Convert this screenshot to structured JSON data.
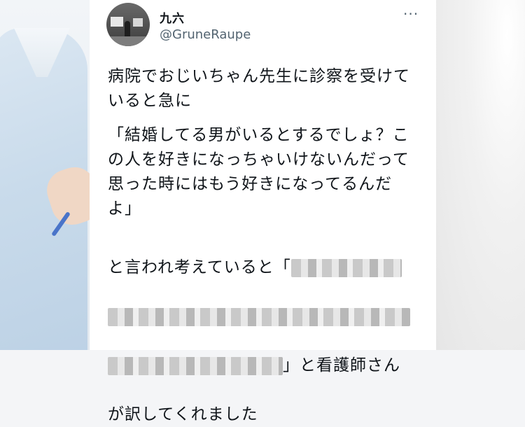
{
  "user": {
    "display_name": "九六",
    "handle": "@GruneRaupe"
  },
  "menu": {
    "more_label": "···"
  },
  "tweet": {
    "para1": "病院でおじいちゃん先生に診察を受けていると急に",
    "para2": "「結婚してる男がいるとするでしょ？この人を好きになっちゃいけないんだって思った時にはもう好きになってるんだよ」",
    "para3_prefix": "と言われ考えていると「",
    "para3_suffix": "」と看護師さん",
    "para4": "が訳してくれました"
  },
  "colors": {
    "text": "#0f1419",
    "secondary": "#536471"
  }
}
